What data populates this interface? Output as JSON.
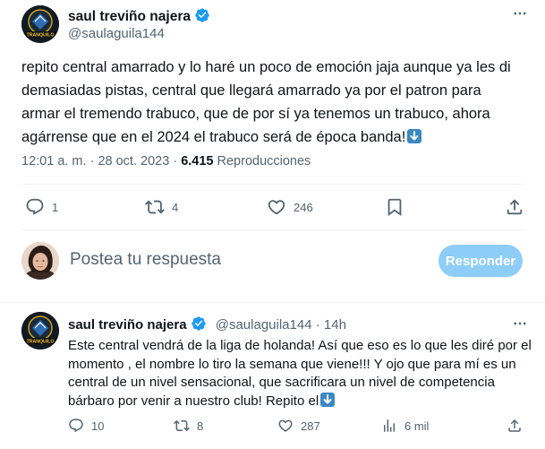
{
  "tweet": {
    "author_name": "saul treviño najera",
    "author_handle": "@saulaguila144",
    "avatar_caption": "TRANQUILO",
    "text": "repito central amarrado y lo haré un poco de emoción jaja aunque ya les di demasiadas pistas, central que llegará amarrado ya por el patron para armar el tremendo trabuco, que de por sí ya tenemos un trabuco, ahora agárrense que en el 2024 el trabuco será de época banda!",
    "emoji": "down-arrow-emoji",
    "time": "12:01 a. m.",
    "separator": "·",
    "date": "28 oct. 2023",
    "views_count": "6.415",
    "views_label": "Reproducciones",
    "actions": {
      "replies": "1",
      "retweets": "4",
      "likes": "246"
    }
  },
  "reply_box": {
    "placeholder": "Postea tu respuesta",
    "button_label": "Responder"
  },
  "reply": {
    "author_name": "saul treviño najera",
    "author_handle": "@saulaguila144",
    "separator": "·",
    "time": "14h",
    "text": "Este central vendrá de la liga de holanda! Así que eso es lo que les diré por el momento , el nombre lo tiro la semana que viene!!! Y ojo que para mí es un central de un nivel sensacional, que sacrificara un nivel de competencia bárbaro por venir a nuestro club! Repito el",
    "emoji": "down-arrow-emoji",
    "actions": {
      "replies": "10",
      "retweets": "8",
      "likes": "287",
      "views": "6 mil"
    }
  },
  "colors": {
    "verified": "#1d9bf0",
    "text": "#0f1419",
    "secondary": "#536471",
    "reply_button": "#8ecdf8"
  }
}
